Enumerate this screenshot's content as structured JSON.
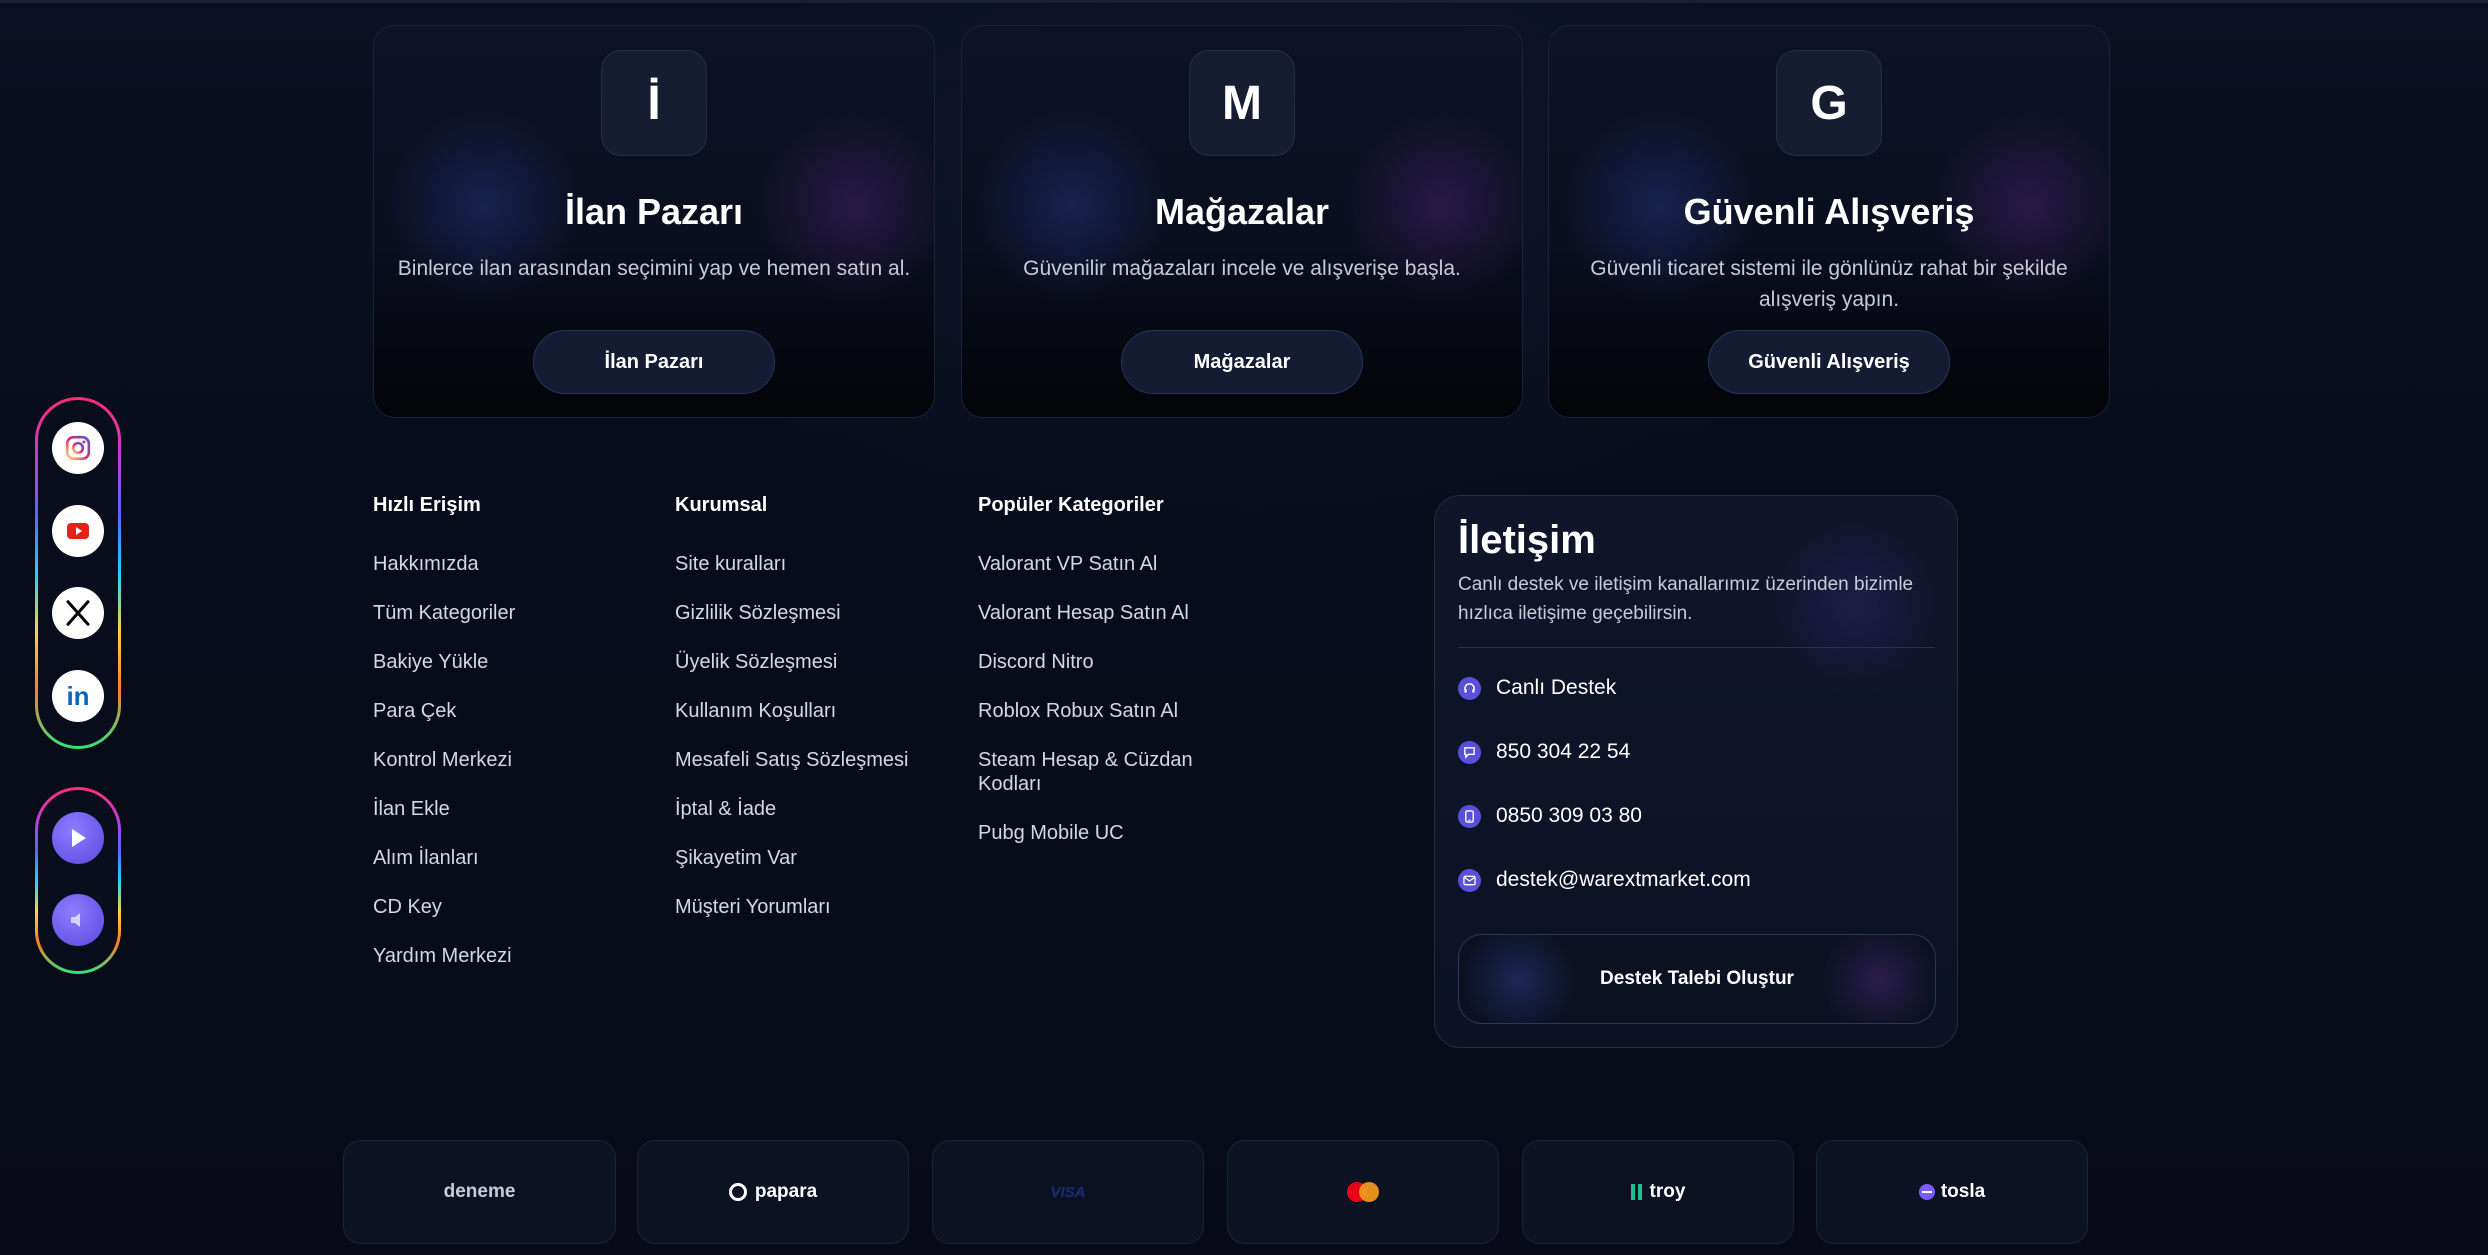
{
  "cards": [
    {
      "badge": "İ",
      "title": "İlan Pazarı",
      "desc": "Binlerce ilan arasından seçimini yap ve hemen satın al.",
      "button": "İlan Pazarı"
    },
    {
      "badge": "M",
      "title": "Mağazalar",
      "desc": "Güvenilir mağazaları incele ve alışverişe başla.",
      "button": "Mağazalar"
    },
    {
      "badge": "G",
      "title": "Güvenli Alışveriş",
      "desc": "Güvenli ticaret sistemi ile gönlünüz rahat bir şekilde alışveriş yapın.",
      "button": "Güvenli Alışveriş"
    }
  ],
  "social": {
    "icons": [
      "instagram-icon",
      "youtube-icon",
      "x-icon",
      "linkedin-icon"
    ],
    "media": [
      "play-icon",
      "volume-icon"
    ]
  },
  "footer": {
    "quick": {
      "title": "Hızlı Erişim",
      "links": [
        "Hakkımızda",
        "Tüm Kategoriler",
        "Bakiye Yükle",
        "Para Çek",
        "Kontrol Merkezi",
        "İlan Ekle",
        "Alım İlanları",
        "CD Key",
        "Yardım Merkezi"
      ]
    },
    "corporate": {
      "title": "Kurumsal",
      "links": [
        "Site kuralları",
        "Gizlilik Sözleşmesi",
        "Üyelik Sözleşmesi",
        "Kullanım Koşulları",
        "Mesafeli Satış Sözleşmesi",
        "İptal & İade",
        "Şikayetim Var",
        "Müşteri Yorumları"
      ]
    },
    "popular": {
      "title": "Popüler Kategoriler",
      "links": [
        "Valorant VP Satın Al",
        "Valorant Hesap Satın Al",
        "Discord Nitro",
        "Roblox Robux Satın Al",
        "Steam Hesap & Cüzdan Kodları",
        "Pubg Mobile UC"
      ]
    }
  },
  "contact": {
    "title": "İletişim",
    "desc": "Canlı destek ve iletişim kanallarımız üzerinden bizimle hızlıca iletişime geçebilirsin.",
    "rows": [
      "Canlı Destek",
      "850 304 22 54",
      "0850 309 03 80",
      "destek@warextmarket.com"
    ],
    "button": "Destek Talebi Oluştur"
  },
  "payments": [
    "deneme",
    "papara",
    "VISA",
    "",
    "troy",
    "tosla"
  ],
  "colors": {
    "accent": "#5a4fd8",
    "background": "#080c1a"
  }
}
